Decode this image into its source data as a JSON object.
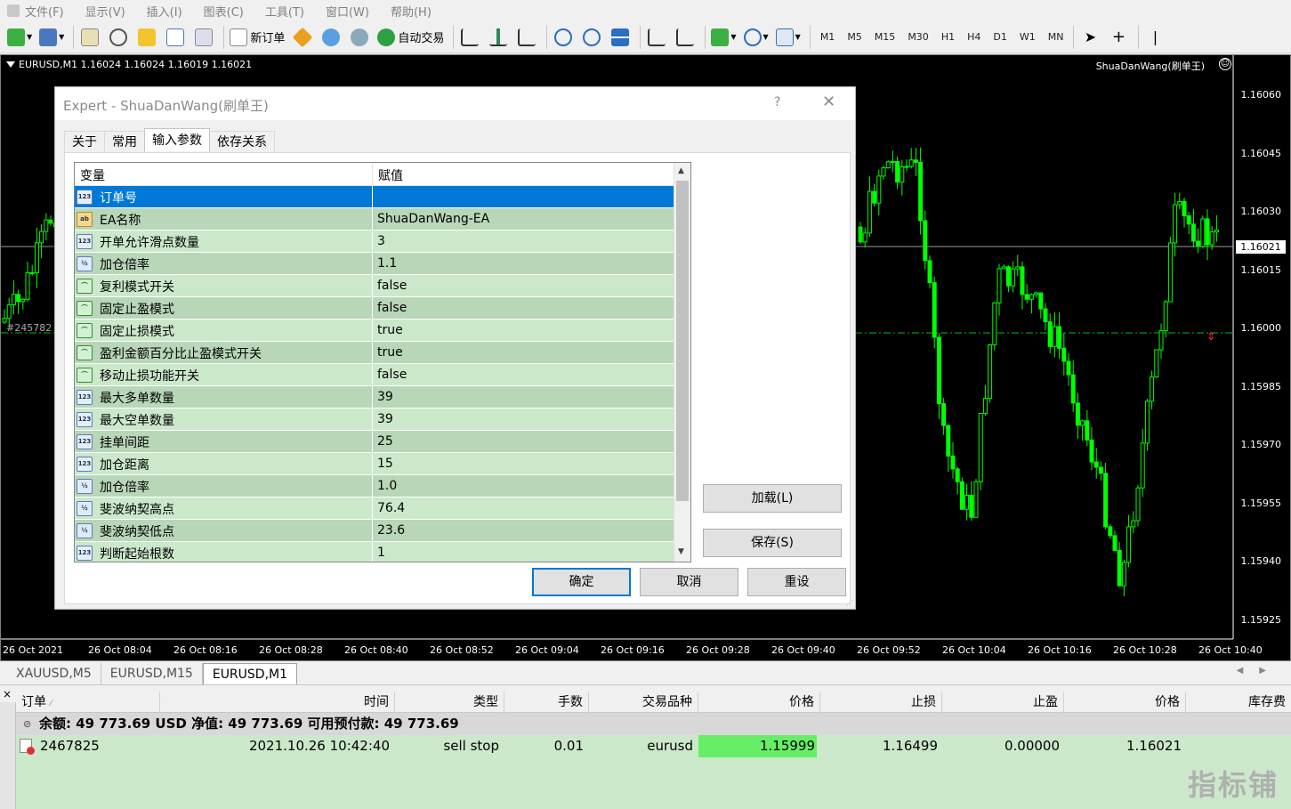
{
  "menu": [
    "文件(F)",
    "显示(V)",
    "插入(I)",
    "图表(C)",
    "工具(T)",
    "窗口(W)",
    "帮助(H)"
  ],
  "toolbar": {
    "new_order": "新订单",
    "auto_trading": "自动交易",
    "timeframes": [
      "M1",
      "M5",
      "M15",
      "M30",
      "H1",
      "H4",
      "D1",
      "W1",
      "MN"
    ]
  },
  "chart": {
    "symbol_line": "EURUSD,M1  1.16024 1.16024 1.16019 1.16021",
    "ea_name": "ShuaDanWang(刷单王)",
    "order_label": "#245782",
    "current_price": "1.16021",
    "price_labels": [
      "1.16060",
      "1.16045",
      "1.16030",
      "1.16015",
      "1.16000",
      "1.15985",
      "1.15970",
      "1.15955",
      "1.15940",
      "1.15925"
    ],
    "time_labels": [
      "26 Oct 2021",
      "26 Oct 08:04",
      "26 Oct 08:16",
      "26 Oct 08:28",
      "26 Oct 08:40",
      "26 Oct 08:52",
      "26 Oct 09:04",
      "26 Oct 09:16",
      "26 Oct 09:28",
      "26 Oct 09:40",
      "26 Oct 09:52",
      "26 Oct 10:04",
      "26 Oct 10:16",
      "26 Oct 10:28",
      "26 Oct 10:40"
    ],
    "bull_color": "#00ff00",
    "bear_color": "#000000"
  },
  "chart_tabs": [
    {
      "label": "XAUUSD,M5",
      "active": false
    },
    {
      "label": "EURUSD,M15",
      "active": false
    },
    {
      "label": "EURUSD,M1",
      "active": true
    }
  ],
  "dialog": {
    "title": "Expert - ShuaDanWang(刷单王)",
    "help": "?",
    "tabs": [
      "关于",
      "常用",
      "输入参数",
      "依存关系"
    ],
    "active_tab": 2,
    "columns": [
      "变量",
      "赋值"
    ],
    "params": [
      {
        "type": "123",
        "name": "订单号",
        "value": "",
        "selected": true
      },
      {
        "type": "ab",
        "name": "EA名称",
        "value": "ShuaDanWang-EA"
      },
      {
        "type": "123",
        "name": "开单允许滑点数量",
        "value": "3"
      },
      {
        "type": "1/2",
        "name": "加仓倍率",
        "value": "1.1"
      },
      {
        "type": "bool",
        "name": "复利模式开关",
        "value": "false"
      },
      {
        "type": "bool",
        "name": "固定止盈模式",
        "value": "false"
      },
      {
        "type": "bool",
        "name": "固定止损模式",
        "value": "true"
      },
      {
        "type": "bool",
        "name": "盈利金额百分比止盈模式开关",
        "value": "true"
      },
      {
        "type": "bool",
        "name": "移动止损功能开关",
        "value": "false"
      },
      {
        "type": "123",
        "name": "最大多单数量",
        "value": "39"
      },
      {
        "type": "123",
        "name": "最大空单数量",
        "value": "39"
      },
      {
        "type": "123",
        "name": "挂单间距",
        "value": "25"
      },
      {
        "type": "123",
        "name": "加仓距离",
        "value": "15"
      },
      {
        "type": "1/2",
        "name": "加仓倍率",
        "value": "1.0"
      },
      {
        "type": "1/2",
        "name": "斐波纳契高点",
        "value": "76.4"
      },
      {
        "type": "1/2",
        "name": "斐波纳契低点",
        "value": "23.6"
      },
      {
        "type": "123",
        "name": "判断起始根数",
        "value": "1"
      }
    ],
    "load_label": "加载(L)",
    "save_label": "保存(S)",
    "ok_label": "确定",
    "cancel_label": "取消",
    "reset_label": "重设"
  },
  "terminal": {
    "columns": [
      "订单",
      "时间",
      "类型",
      "手数",
      "交易品种",
      "价格",
      "止损",
      "止盈",
      "价格",
      "库存费"
    ],
    "balance_line": "余额: 49 773.69 USD  净值: 49 773.69  可用预付款: 49 773.69",
    "order": {
      "ticket": "2467825",
      "time": "2021.10.26 10:42:40",
      "type": "sell stop",
      "lots": "0.01",
      "symbol": "eurusd",
      "price": "1.15999",
      "sl": "1.16499",
      "tp": "0.00000",
      "current_price": "1.16021"
    },
    "price_highlight": "#66ee66"
  },
  "watermark": "指标铺"
}
